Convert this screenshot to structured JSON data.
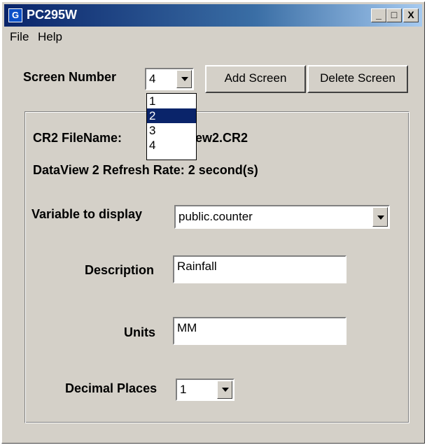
{
  "window": {
    "title": "PC295W",
    "app_icon": "app-logo-icon"
  },
  "title_buttons": {
    "minimize": "_",
    "maximize": "□",
    "close": "X"
  },
  "menu": [
    {
      "label": "File",
      "accel": "F"
    },
    {
      "label": "Help",
      "accel": "H"
    }
  ],
  "toolbar": {
    "screen_number_label": "Screen Number",
    "screen_number_value": "4",
    "add_screen": "Add Screen",
    "delete_screen": "Delete Screen",
    "dropdown_options": [
      "1",
      "2",
      "3",
      "4"
    ],
    "dropdown_selected": "2"
  },
  "panel": {
    "cr2_label": "CR2 FileName:",
    "cr2_value_visible": "ew2.CR2",
    "refresh": "DataView 2 Refresh Rate: 2 second(s)",
    "variable_label": "Variable to display",
    "variable_value": "public.counter",
    "description_label": "Description",
    "description_value": "Rainfall",
    "units_label": "Units",
    "units_value": "MM",
    "decimal_label": "Decimal Places",
    "decimal_value": "1"
  },
  "colors": {
    "titlebar_start": "#0a246a",
    "face": "#d4d0c8",
    "highlight": "#0a246a"
  }
}
